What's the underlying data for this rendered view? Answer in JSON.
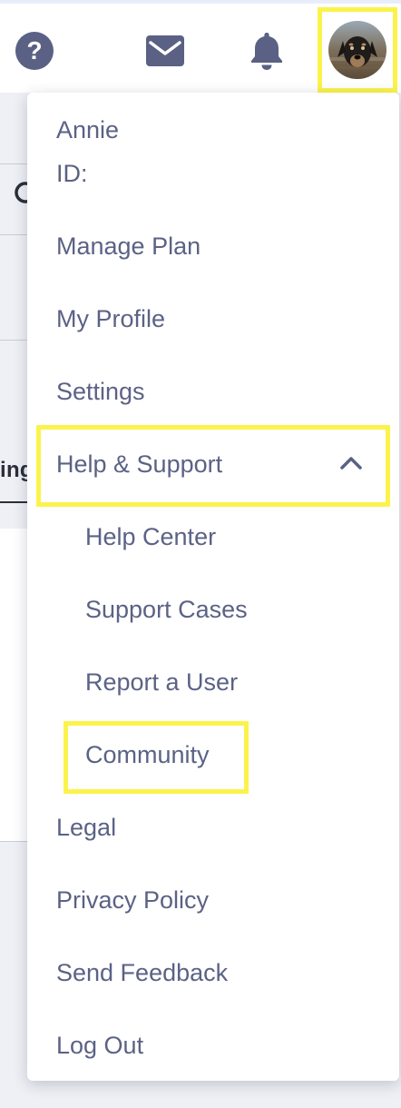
{
  "header": {
    "icons": [
      "help-circle-icon",
      "mail-icon",
      "bell-icon"
    ],
    "avatar_description": "user avatar photo"
  },
  "background": {
    "fragment_text": "ing"
  },
  "menu": {
    "user_name": "Annie",
    "user_id_label": "ID:",
    "items": [
      "Manage Plan",
      "My Profile",
      "Settings"
    ],
    "help_support": {
      "label": "Help & Support",
      "expanded": true,
      "subitems": [
        "Help Center",
        "Support Cases",
        "Report a User",
        "Community"
      ]
    },
    "bottom_items": [
      "Legal",
      "Privacy Policy",
      "Send Feedback",
      "Log Out"
    ]
  },
  "colors": {
    "highlight": "#fbf34c",
    "menu_text": "#5b6285",
    "icon": "#5a6184"
  }
}
